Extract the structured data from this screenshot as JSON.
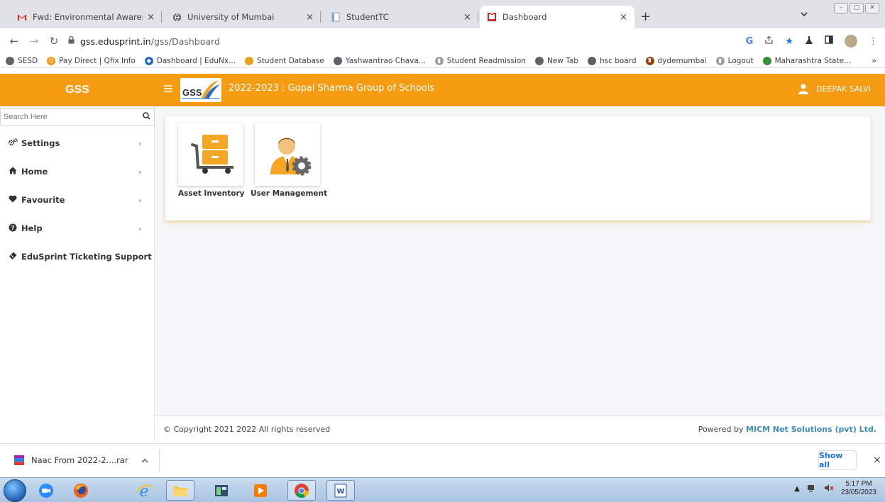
{
  "browser": {
    "tabs": [
      {
        "title": "Fwd: Environmental Awareness C",
        "icon": "gmail-icon",
        "active": false
      },
      {
        "title": "University of Mumbai",
        "icon": "globe-icon",
        "active": false
      },
      {
        "title": "StudentTC",
        "icon": "page-icon",
        "active": false
      },
      {
        "title": "Dashboard",
        "icon": "site-icon",
        "active": true
      }
    ],
    "close_glyph": "×",
    "new_tab_glyph": "+",
    "url_host": "gss.edusprint.in",
    "url_path": "/gss/Dashboard",
    "bookmarks": [
      {
        "label": "SESD",
        "icon": "globe-icon",
        "color": "#5f6368"
      },
      {
        "label": "Pay Direct | Qfix Info",
        "icon": "search-q-icon",
        "color": "#f39c12"
      },
      {
        "label": "Dashboard | EduNx...",
        "icon": "edunx-icon",
        "color": "#2a6fbd"
      },
      {
        "label": "Student Database",
        "icon": "circle-icon",
        "color": "#e8a11a"
      },
      {
        "label": "Yashwantrao Chava...",
        "icon": "globe-icon",
        "color": "#5f6368"
      },
      {
        "label": "Student Readmission",
        "icon": "page-icon",
        "color": "#9aa0a6"
      },
      {
        "label": "New Tab",
        "icon": "globe-icon",
        "color": "#5f6368"
      },
      {
        "label": "hsc board",
        "icon": "globe-icon",
        "color": "#5f6368"
      },
      {
        "label": "dydemumbai",
        "icon": "emblem-icon",
        "color": "#8b4513"
      },
      {
        "label": "Logout",
        "icon": "page-icon",
        "color": "#9aa0a6"
      },
      {
        "label": "Maharashtra State...",
        "icon": "circle-icon",
        "color": "#3a8f3a"
      }
    ],
    "bookmarks_more": "»"
  },
  "app": {
    "brand": "GSS",
    "logo_text": "GSS",
    "school_title": "2022-2023 : Gopal Sharma Group of Schools",
    "user_name": "DEEPAK SALVI",
    "accent_color": "#f39c12"
  },
  "sidebar": {
    "search_placeholder": "Search Here",
    "items": [
      {
        "label": "Settings",
        "icon": "cogs-icon",
        "has_chevron": true
      },
      {
        "label": "Home",
        "icon": "home-icon",
        "has_chevron": true
      },
      {
        "label": "Favourite",
        "icon": "heart-icon",
        "has_chevron": true
      },
      {
        "label": "Help",
        "icon": "help-icon",
        "has_chevron": true
      },
      {
        "label": "EduSprint Ticketing Support",
        "icon": "ticket-icon",
        "has_chevron": false
      }
    ],
    "chevron": "‹"
  },
  "dashboard": {
    "tiles": [
      {
        "label": "Asset Inventory",
        "icon": "inventory-cart-icon"
      },
      {
        "label": "User Management",
        "icon": "user-gear-icon"
      }
    ]
  },
  "footer": {
    "copyright": "© Copyright 2021 2022 All rights reserved",
    "powered_prefix": "Powered by ",
    "powered_brand": "MICM Net Solutions (pvt) Ltd."
  },
  "downloads": {
    "item_name": "Naac From 2022-2....rar",
    "show_all": "Show all",
    "close": "×"
  },
  "taskbar": {
    "time": "5:17 PM",
    "date": "23/05/2023"
  }
}
